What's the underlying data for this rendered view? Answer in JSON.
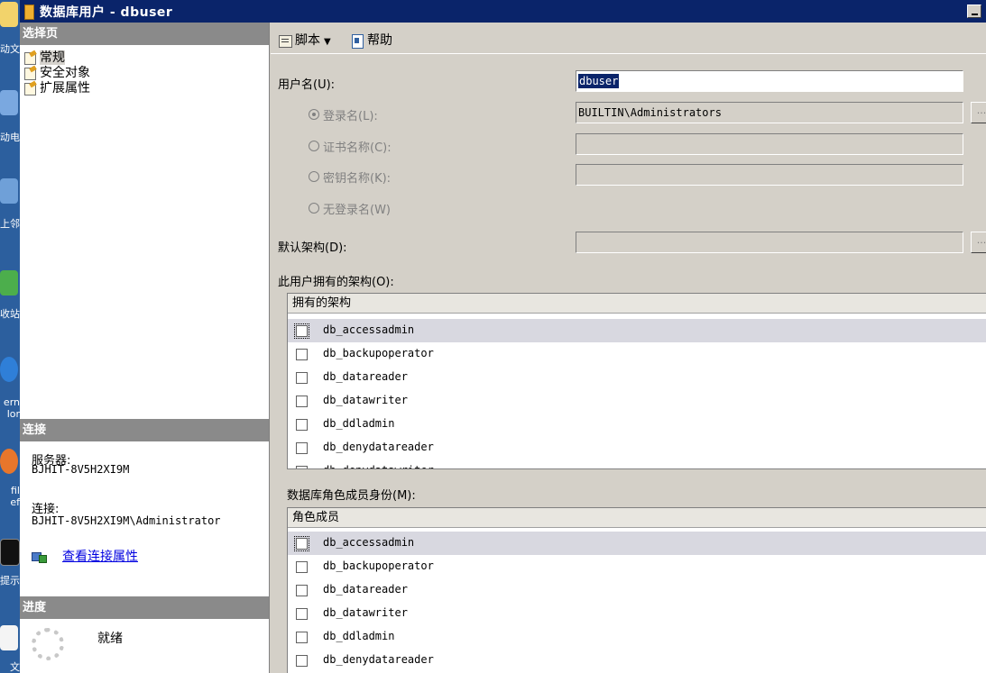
{
  "desktop": {
    "icons": [
      {
        "label": "动文",
        "icon": "document-icon"
      },
      {
        "label": "动电",
        "icon": "computer-icon"
      },
      {
        "label": "上邻",
        "icon": "network-icon"
      },
      {
        "label": "收站",
        "icon": "recycle-bin-icon"
      },
      {
        "label": "ern\nlor",
        "icon": "internet-explorer-icon"
      },
      {
        "label": "fil\nef",
        "icon": "firefox-icon"
      },
      {
        "label": "提示",
        "icon": "command-prompt-icon"
      },
      {
        "label": "文",
        "icon": "notepad-icon"
      }
    ]
  },
  "window": {
    "title": "数据库用户 - dbuser"
  },
  "left": {
    "pages_header": "选择页",
    "pages": [
      {
        "label": "常规",
        "selected": true,
        "icon": "page-icon"
      },
      {
        "label": "安全对象",
        "selected": false,
        "icon": "page-icon"
      },
      {
        "label": "扩展属性",
        "selected": false,
        "icon": "page-icon"
      }
    ],
    "connection_header": "连接",
    "server_label": "服务器:",
    "server_value": "BJHIT-8V5H2XI9M",
    "connection_label": "连接:",
    "connection_value": "BJHIT-8V5H2XI9M\\Administrator",
    "view_connection_link": "查看连接属性",
    "progress_header": "进度",
    "progress_status": "就绪"
  },
  "toolbar": {
    "script_label": "脚本",
    "help_label": "帮助"
  },
  "form": {
    "username_label": "用户名(U):",
    "username_value": "dbuser",
    "login_radio_label": "登录名(L):",
    "login_value": "BUILTIN\\Administrators",
    "cert_radio_label": "证书名称(C):",
    "key_radio_label": "密钥名称(K):",
    "nologin_radio_label": "无登录名(W)",
    "default_schema_label": "默认架构(D):",
    "default_schema_value": "",
    "browse_label": "...",
    "owned_schemas_label": "此用户拥有的架构(O):",
    "owned_schemas_header": "拥有的架构",
    "owned_schemas": [
      "db_accessadmin",
      "db_backupoperator",
      "db_datareader",
      "db_datawriter",
      "db_ddladmin",
      "db_denydatareader",
      "db_denydatawriter"
    ],
    "role_membership_label": "数据库角色成员身份(M):",
    "role_members_header": "角色成员",
    "role_members": [
      "db_accessadmin",
      "db_backupoperator",
      "db_datareader",
      "db_datawriter",
      "db_ddladmin",
      "db_denydatareader"
    ]
  }
}
